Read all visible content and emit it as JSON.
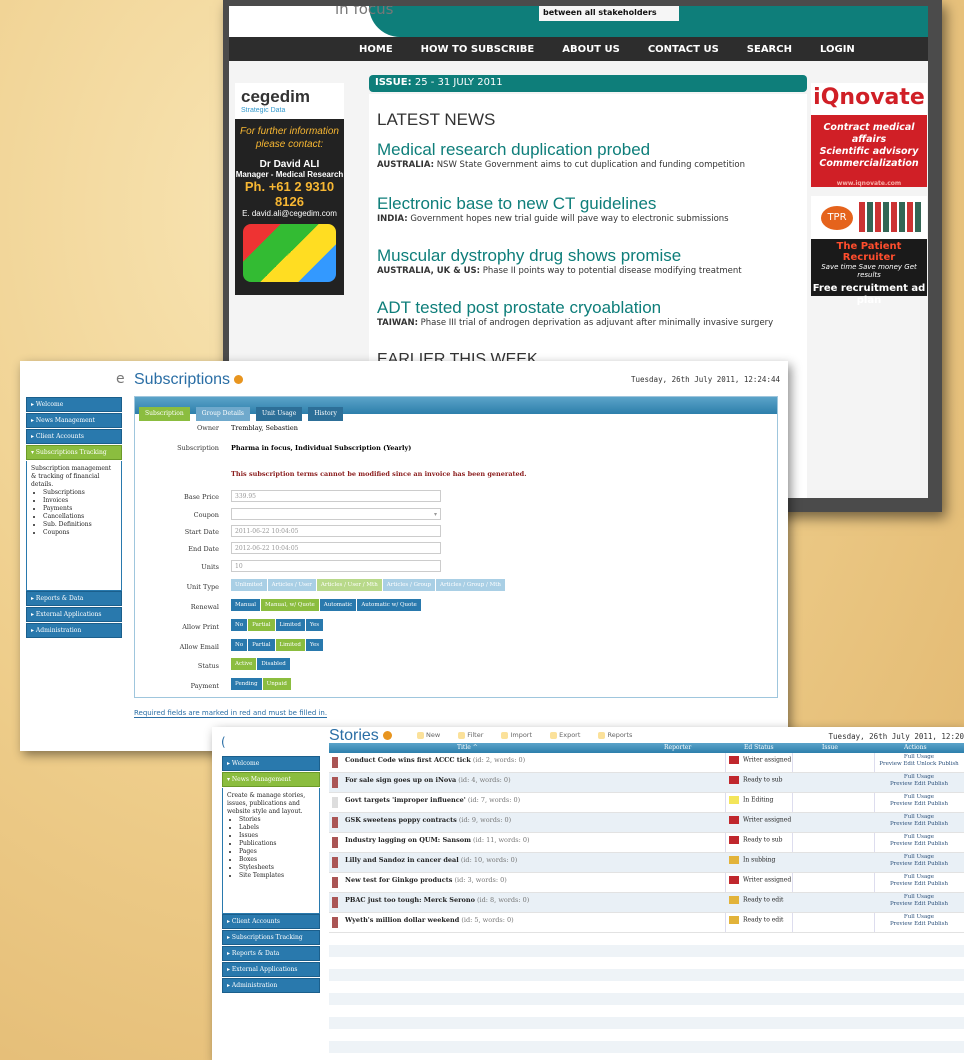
{
  "news": {
    "tagline": "in focus",
    "banner": "between all stakeholders",
    "nav": [
      "HOME",
      "HOW TO SUBSCRIBE",
      "ABOUT US",
      "CONTACT US",
      "SEARCH",
      "LOGIN"
    ],
    "issue_label": "ISSUE:",
    "issue_value": "25 - 31 JULY 2011",
    "latest_heading": "LATEST NEWS",
    "stories": [
      {
        "title": "Medical research duplication probed",
        "region": "AUSTRALIA:",
        "summary": "NSW State Government aims to cut duplication and funding competition"
      },
      {
        "title": "Electronic base to new CT guidelines",
        "region": "INDIA:",
        "summary": "Government hopes new trial guide will pave way to electronic submissions"
      },
      {
        "title": "Muscular dystrophy drug shows promise",
        "region": "AUSTRALIA, UK & US:",
        "summary": "Phase II points way to potential disease modifying treatment"
      },
      {
        "title": "ADT tested post prostate cryoablation",
        "region": "TAIWAN:",
        "summary": "Phase III trial of androgen deprivation as adjuvant after minimally invasive surgery"
      }
    ],
    "earlier_heading": "EARLIER THIS WEEK",
    "cegedim": {
      "logo": "cegedim",
      "logo_sub": "Strategic Data",
      "contact": "For further information please contact:",
      "name": "Dr David ALI",
      "role": "Manager - Medical Research",
      "phone": "Ph. +61 2 9310 8126",
      "email": "E. david.ali@cegedim.com"
    },
    "iqnovate": {
      "logo": "iQnovate",
      "lines": [
        "Contract medical affairs",
        "Scientific advisory",
        "Commercialization"
      ],
      "url": "www.iqnovate.com"
    },
    "tpr": {
      "badge": "TPR",
      "title": "The Patient Recruiter",
      "tagline": "Save time Save money Get results",
      "offer": "Free recruitment ad plan"
    }
  },
  "subscriptions": {
    "title": "Subscriptions",
    "date": "Tuesday, 26th July 2011, 12:24:44",
    "sidebar": {
      "items_top": [
        "Welcome",
        "News Management",
        "Client Accounts",
        "Subscriptions Tracking"
      ],
      "description": "Subscription management & tracking of financial details.",
      "links": [
        "Subscriptions",
        "Invoices",
        "Payments",
        "Cancellations",
        "Sub. Definitions",
        "Coupons"
      ],
      "items_bottom": [
        "Reports & Data",
        "External Applications",
        "Administration"
      ]
    },
    "tabs": [
      "Subscription",
      "Group Details",
      "Unit Usage",
      "History"
    ],
    "owner_label": "Owner",
    "owner_value": "Tremblay, Sebastien",
    "subscription_label": "Subscription",
    "subscription_value": "Pharma in focus, Individual Subscription (Yearly)",
    "warning": "This subscription terms cannot be modified since an invoice has been generated.",
    "base_price_label": "Base Price",
    "base_price_value": "339.95",
    "coupon_label": "Coupon",
    "start_label": "Start Date",
    "start_value": "2011-06-22 10:04:05",
    "end_label": "End Date",
    "end_value": "2012-06-22 10:04:05",
    "units_label": "Units",
    "units_value": "10",
    "unit_type_label": "Unit Type",
    "unit_type_options": [
      "Unlimited",
      "Articles / User",
      "Articles / User / Mth",
      "Articles / Group",
      "Articles / Group / Mth"
    ],
    "renewal_label": "Renewal",
    "renewal_options": [
      "Manual",
      "Manual, w/ Quote",
      "Automatic",
      "Automatic w/ Quote"
    ],
    "allow_print_label": "Allow Print",
    "allow_print_options": [
      "No",
      "Partial",
      "Limited",
      "Yes"
    ],
    "allow_email_label": "Allow Email",
    "allow_email_options": [
      "No",
      "Partial",
      "Limited",
      "Yes"
    ],
    "status_label": "Status",
    "status_options": [
      "Active",
      "Disabled"
    ],
    "payment_label": "Payment",
    "payment_options": [
      "Pending",
      "Unpaid"
    ],
    "footer": "Required fields are marked in red and must be filled in."
  },
  "stories": {
    "title": "Stories",
    "date": "Tuesday, 26th July 2011, 12:20",
    "toolbar": [
      "New",
      "Filter",
      "Import",
      "Export",
      "Reports"
    ],
    "sidebar": {
      "items_top": [
        "Welcome",
        "News Management"
      ],
      "description": "Create & manage stories, issues, publications and website style and layout.",
      "links": [
        "Stories",
        "Labels",
        "Issues",
        "Publications",
        "Pages",
        "Boxes",
        "Stylesheets",
        "Site Templates"
      ],
      "items_bottom": [
        "Client Accounts",
        "Subscriptions Tracking",
        "Reports & Data",
        "External Applications",
        "Administration"
      ]
    },
    "columns": [
      "Title ^",
      "Reporter",
      "Ed Status",
      "Issue",
      "Actions"
    ],
    "rows": [
      {
        "title": "Conduct Code wins first ACCC tick",
        "meta": "(id: 2, words: 0)",
        "status": "Writer assigned",
        "status_color": "#c0272d",
        "actions1": "Full Usage",
        "actions2": "Preview  Edit  Unlock  Publish"
      },
      {
        "title": "For sale sign goes up on iNova",
        "meta": "(id: 4, words: 0)",
        "status": "Ready to sub",
        "status_color": "#c0272d",
        "actions1": "Full Usage",
        "actions2": "Preview  Edit  Publish"
      },
      {
        "title": "Govt targets 'improper influence'",
        "meta": "(id: 7, words: 0)",
        "status": "In Editing",
        "status_color": "#f3e55a",
        "actions1": "Full Usage",
        "actions2": "Preview  Edit  Publish"
      },
      {
        "title": "GSK sweetens poppy contracts",
        "meta": "(id: 9, words: 0)",
        "status": "Writer assigned",
        "status_color": "#c0272d",
        "actions1": "Full Usage",
        "actions2": "Preview  Edit  Publish"
      },
      {
        "title": "Industry lagging on QUM: Sansom",
        "meta": "(id: 11, words: 0)",
        "status": "Ready to sub",
        "status_color": "#c0272d",
        "actions1": "Full Usage",
        "actions2": "Preview  Edit  Publish"
      },
      {
        "title": "Lilly and Sandoz in cancer deal",
        "meta": "(id: 10, words: 0)",
        "status": "In subbing",
        "status_color": "#e2b33a",
        "actions1": "Full Usage",
        "actions2": "Preview  Edit  Publish"
      },
      {
        "title": "New test for Ginkgo products",
        "meta": "(id: 3, words: 0)",
        "status": "Writer assigned",
        "status_color": "#c0272d",
        "actions1": "Full Usage",
        "actions2": "Preview  Edit  Publish"
      },
      {
        "title": "PBAC just too tough: Merck Serono",
        "meta": "(id: 8, words: 0)",
        "status": "Ready to edit",
        "status_color": "#e2b33a",
        "actions1": "Full Usage",
        "actions2": "Preview  Edit  Publish"
      },
      {
        "title": "Wyeth's million dollar weekend",
        "meta": "(id: 5, words: 0)",
        "status": "Ready to edit",
        "status_color": "#e2b33a",
        "actions1": "Full Usage",
        "actions2": "Preview  Edit  Publish"
      }
    ]
  }
}
